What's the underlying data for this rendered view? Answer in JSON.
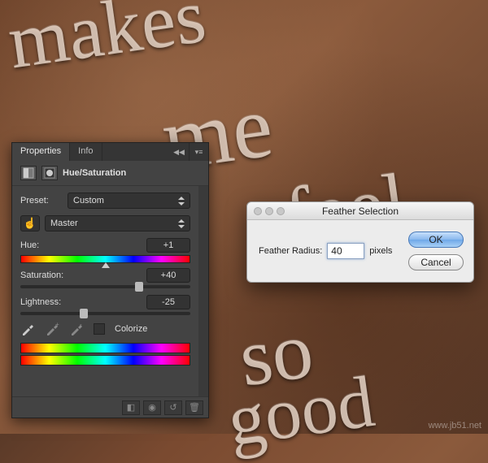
{
  "panel": {
    "tabs": {
      "properties": "Properties",
      "info": "Info"
    },
    "adjustment_title": "Hue/Saturation",
    "preset_label": "Preset:",
    "preset_value": "Custom",
    "channel_value": "Master",
    "hue": {
      "label": "Hue:",
      "value": "+1"
    },
    "saturation": {
      "label": "Saturation:",
      "value": "+40"
    },
    "lightness": {
      "label": "Lightness:",
      "value": "-25"
    },
    "colorize_label": "Colorize"
  },
  "dialog": {
    "title": "Feather Selection",
    "radius_label": "Feather Radius:",
    "radius_value": "40",
    "radius_unit": "pixels",
    "ok": "OK",
    "cancel": "Cancel"
  },
  "bgtext": {
    "l1": "makes",
    "l2": "me",
    "l3": "feel",
    "l4": "so",
    "l5": "good"
  },
  "watermark": "www.jb51.net"
}
